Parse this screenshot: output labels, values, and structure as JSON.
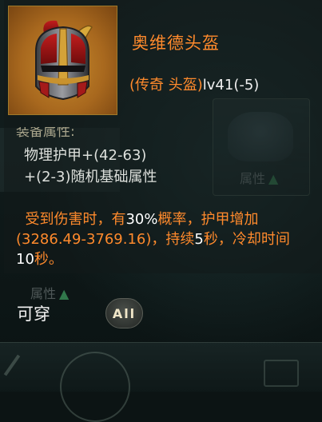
{
  "item": {
    "name": "奥维德头盔",
    "quality_slot": "(传奇 头盔)",
    "level": "lv41(-5)"
  },
  "attributes": {
    "header": "装备属性:",
    "stat_1": "物理护甲+(42-63)",
    "stat_2": "+(2-3)随机基础属性"
  },
  "skill": {
    "part1": "受到伤害时，有",
    "value1": "30%",
    "part2": "概率，护甲增加(3286.49-3769.16)，持续",
    "value2": "5",
    "part3": "秒，冷却时间",
    "value3": "10",
    "part4": "秒。"
  },
  "footer": {
    "wearable_label": "可穿",
    "all_button": "All"
  },
  "background": {
    "attr_button_label": "属性",
    "attr_button_label_2": "属性"
  },
  "colors": {
    "legendary_orange": "#ff8a2c",
    "stat_text": "#dde0dc",
    "frame_gold": "#a07a2a"
  }
}
